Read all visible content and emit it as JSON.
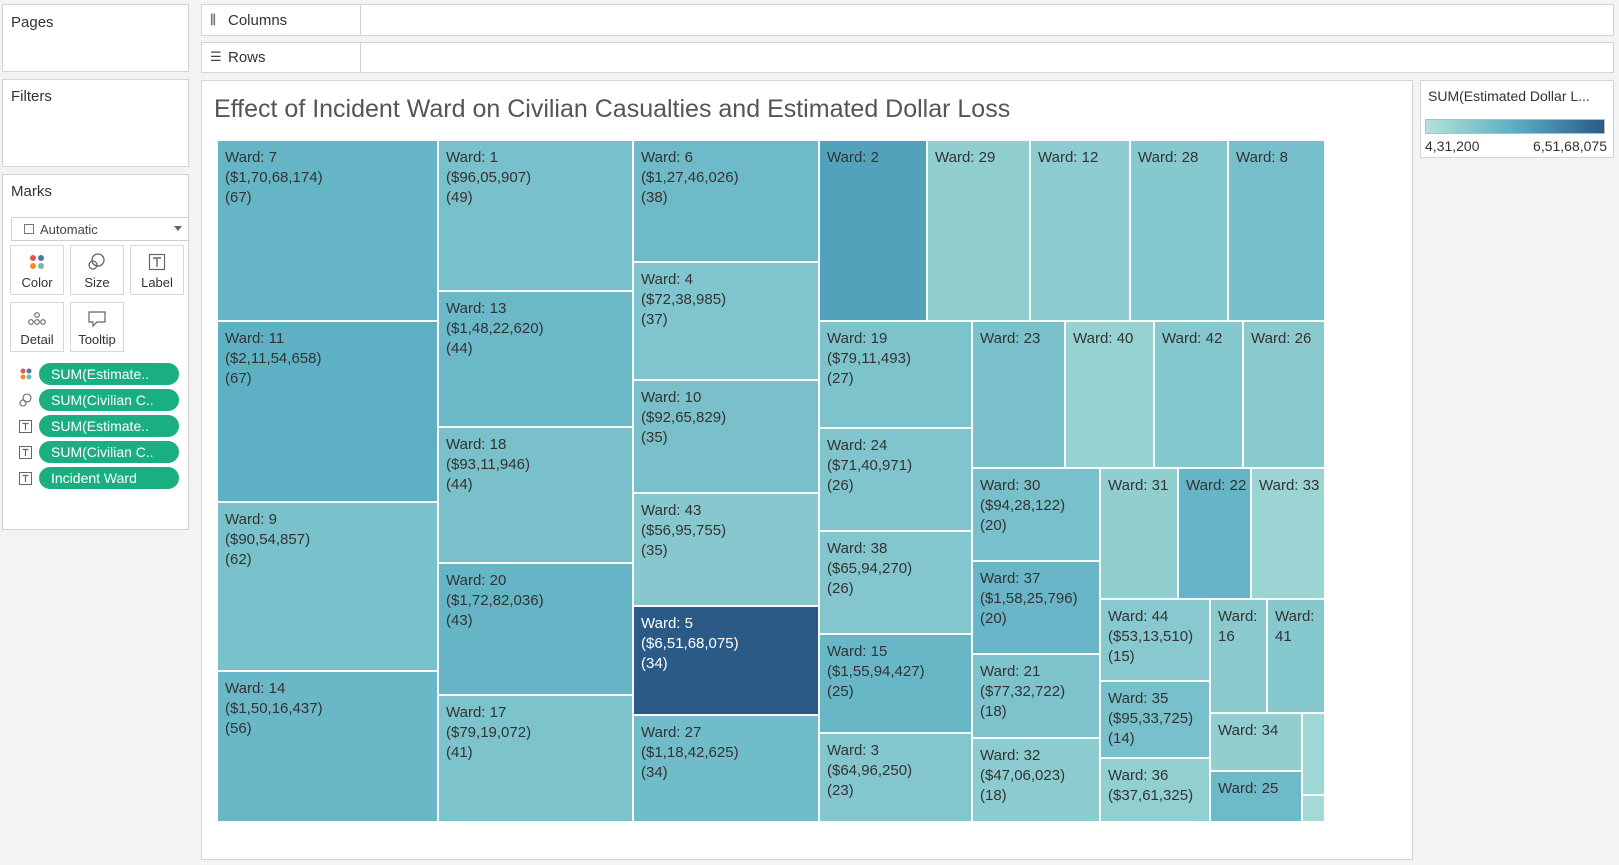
{
  "pages": {
    "title": "Pages"
  },
  "filters": {
    "title": "Filters"
  },
  "shelves": {
    "columns": "Columns",
    "rows": "Rows"
  },
  "marks": {
    "title": "Marks",
    "mark_type": "Automatic",
    "buttons": {
      "color": "Color",
      "size": "Size",
      "label": "Label",
      "detail": "Detail",
      "tooltip": "Tooltip"
    },
    "pills": [
      {
        "icon": "color-icon",
        "text": "SUM(Estimate.."
      },
      {
        "icon": "size-icon",
        "text": "SUM(Civilian C.."
      },
      {
        "icon": "label-icon",
        "text": "SUM(Estimate.."
      },
      {
        "icon": "label-icon",
        "text": "SUM(Civilian C.."
      },
      {
        "icon": "label-icon",
        "text": "Incident Ward"
      }
    ]
  },
  "legend": {
    "title": "SUM(Estimated Dollar L...",
    "min_label": "4,31,200",
    "max_label": "6,51,68,075",
    "colors": {
      "low": "#b4e2d8",
      "mid": "#5aaec4",
      "high": "#2c5a87"
    }
  },
  "colors": {
    "pill": "#1aaf81",
    "low": "#b4e2d8",
    "high": "#2c5a87"
  },
  "chart_data": {
    "type": "treemap",
    "title": "Effect of Incident Ward on Civilian Casualties and Estimated Dollar Loss",
    "size_measure": "SUM(Civilian Casualties)",
    "color_measure": "SUM(Estimated Dollar Loss)",
    "color_range": [
      431200,
      65168075
    ],
    "cells": [
      {
        "ward": "Ward: 7",
        "loss": "($1,70,68,174)",
        "cas": "(67)",
        "value": 17068174,
        "casualties": 67
      },
      {
        "ward": "Ward: 11",
        "loss": "($2,11,54,658)",
        "cas": "(67)",
        "value": 21154658,
        "casualties": 67
      },
      {
        "ward": "Ward: 9",
        "loss": "($90,54,857)",
        "cas": "(62)",
        "value": 9054857,
        "casualties": 62
      },
      {
        "ward": "Ward: 14",
        "loss": "($1,50,16,437)",
        "cas": "(56)",
        "value": 15016437,
        "casualties": 56
      },
      {
        "ward": "Ward: 1",
        "loss": "($96,05,907)",
        "cas": "(49)",
        "value": 9605907,
        "casualties": 49
      },
      {
        "ward": "Ward: 13",
        "loss": "($1,48,22,620)",
        "cas": "(44)",
        "value": 14822620,
        "casualties": 44
      },
      {
        "ward": "Ward: 18",
        "loss": "($93,11,946)",
        "cas": "(44)",
        "value": 9311946,
        "casualties": 44
      },
      {
        "ward": "Ward: 20",
        "loss": "($1,72,82,036)",
        "cas": "(43)",
        "value": 17282036,
        "casualties": 43
      },
      {
        "ward": "Ward: 17",
        "loss": "($79,19,072)",
        "cas": "(41)",
        "value": 7919072,
        "casualties": 41
      },
      {
        "ward": "Ward: 6",
        "loss": "($1,27,46,026)",
        "cas": "(38)",
        "value": 12746026,
        "casualties": 38
      },
      {
        "ward": "Ward: 4",
        "loss": "($72,38,985)",
        "cas": "(37)",
        "value": 7238985,
        "casualties": 37
      },
      {
        "ward": "Ward: 10",
        "loss": "($92,65,829)",
        "cas": "(35)",
        "value": 9265829,
        "casualties": 35
      },
      {
        "ward": "Ward: 43",
        "loss": "($56,95,755)",
        "cas": "(35)",
        "value": 5695755,
        "casualties": 35
      },
      {
        "ward": "Ward: 5",
        "loss": "($6,51,68,075)",
        "cas": "(34)",
        "value": 65168075,
        "casualties": 34
      },
      {
        "ward": "Ward: 27",
        "loss": "($1,18,42,625)",
        "cas": "(34)",
        "value": 11842625,
        "casualties": 34
      },
      {
        "ward": "Ward: 2",
        "loss": "",
        "cas": "",
        "value": 28000000,
        "casualties": 33
      },
      {
        "ward": "Ward: 29",
        "loss": "",
        "cas": "",
        "value": 4000000,
        "casualties": 31
      },
      {
        "ward": "Ward: 12",
        "loss": "",
        "cas": "",
        "value": 4500000,
        "casualties": 30
      },
      {
        "ward": "Ward: 28",
        "loss": "",
        "cas": "",
        "value": 6000000,
        "casualties": 29
      },
      {
        "ward": "Ward: 8",
        "loss": "",
        "cas": "",
        "value": 10000000,
        "casualties": 28
      },
      {
        "ward": "Ward: 19",
        "loss": "($79,11,493)",
        "cas": "(27)",
        "value": 7911493,
        "casualties": 27
      },
      {
        "ward": "Ward: 24",
        "loss": "($71,40,971)",
        "cas": "(26)",
        "value": 7140971,
        "casualties": 26
      },
      {
        "ward": "Ward: 38",
        "loss": "($65,94,270)",
        "cas": "(26)",
        "value": 6594270,
        "casualties": 26
      },
      {
        "ward": "Ward: 15",
        "loss": "($1,55,94,427)",
        "cas": "(25)",
        "value": 15594427,
        "casualties": 25
      },
      {
        "ward": "Ward: 3",
        "loss": "($64,96,250)",
        "cas": "(23)",
        "value": 6496250,
        "casualties": 23
      },
      {
        "ward": "Ward: 23",
        "loss": "",
        "cas": "",
        "value": 9000000,
        "casualties": 22
      },
      {
        "ward": "Ward: 40",
        "loss": "",
        "cas": "",
        "value": 3000000,
        "casualties": 21
      },
      {
        "ward": "Ward: 42",
        "loss": "",
        "cas": "",
        "value": 6000000,
        "casualties": 21
      },
      {
        "ward": "Ward: 26",
        "loss": "",
        "cas": "",
        "value": 5000000,
        "casualties": 21
      },
      {
        "ward": "Ward: 30",
        "loss": "($94,28,122)",
        "cas": "(20)",
        "value": 9428122,
        "casualties": 20
      },
      {
        "ward": "Ward: 37",
        "loss": "($1,58,25,796)",
        "cas": "(20)",
        "value": 15825796,
        "casualties": 20
      },
      {
        "ward": "Ward: 21",
        "loss": "($77,32,722)",
        "cas": "(18)",
        "value": 7732722,
        "casualties": 18
      },
      {
        "ward": "Ward: 32",
        "loss": "($47,06,023)",
        "cas": "(18)",
        "value": 4706023,
        "casualties": 18
      },
      {
        "ward": "Ward: 31",
        "loss": "",
        "cas": "",
        "value": 4000000,
        "casualties": 17
      },
      {
        "ward": "Ward: 22",
        "loss": "",
        "cas": "",
        "value": 17000000,
        "casualties": 16
      },
      {
        "ward": "Ward: 33",
        "loss": "",
        "cas": "",
        "value": 2500000,
        "casualties": 16
      },
      {
        "ward": "Ward: 44",
        "loss": "($53,13,510)",
        "cas": "(15)",
        "value": 5313510,
        "casualties": 15
      },
      {
        "ward": "Ward: 35",
        "loss": "($95,33,725)",
        "cas": "(14)",
        "value": 9533725,
        "casualties": 14
      },
      {
        "ward": "Ward: 36",
        "loss": "($37,61,325)",
        "cas": "",
        "value": 3761325,
        "casualties": 14
      },
      {
        "ward": "Ward: 16",
        "loss": "",
        "cas": "",
        "value": 5000000,
        "casualties": 13
      },
      {
        "ward": "Ward: 41",
        "loss": "",
        "cas": "",
        "value": 6000000,
        "casualties": 13
      },
      {
        "ward": "Ward: 34",
        "loss": "",
        "cas": "",
        "value": 4000000,
        "casualties": 8
      },
      {
        "ward": "Ward: 25",
        "loss": "",
        "cas": "",
        "value": 13000000,
        "casualties": 7
      },
      {
        "ward": "",
        "loss": "",
        "cas": "",
        "value": 2000000,
        "casualties": 4
      },
      {
        "ward": "",
        "loss": "",
        "cas": "",
        "value": 1500000,
        "casualties": 1
      }
    ]
  }
}
